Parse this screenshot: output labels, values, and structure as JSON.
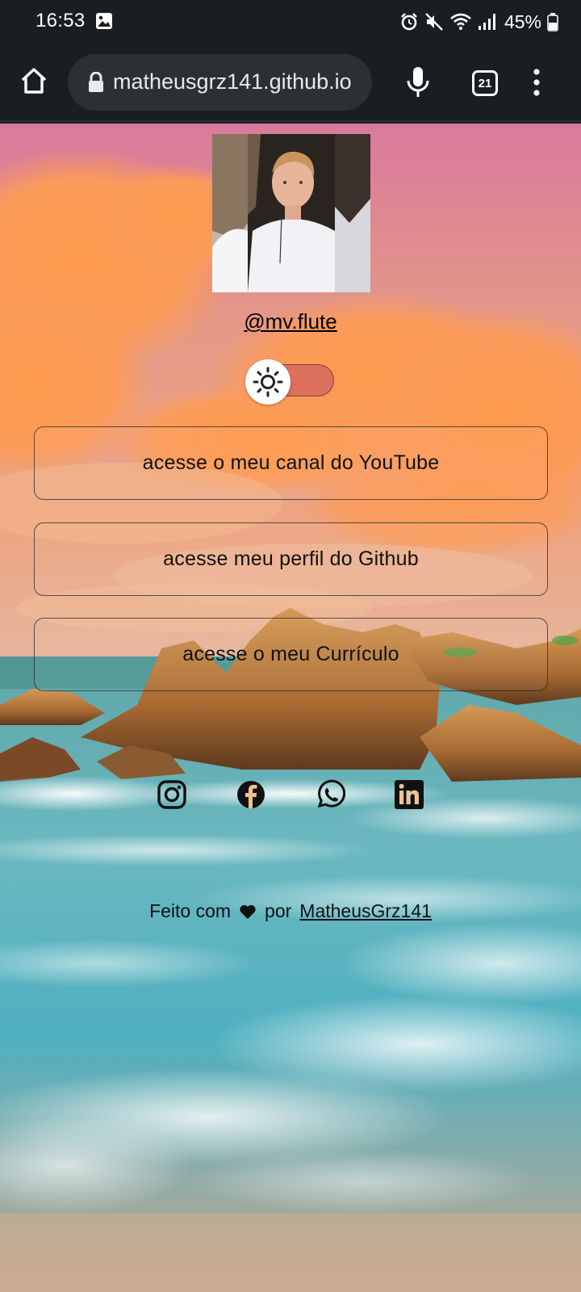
{
  "status_bar": {
    "time": "16:53",
    "battery_percent": "45%",
    "icons": [
      "gallery-icon",
      "alarm-icon",
      "mute-icon",
      "wifi-icon",
      "signal-icon",
      "battery-icon"
    ]
  },
  "browser": {
    "url": "matheusgrz141.github.io",
    "tab_count": "21",
    "icons": [
      "home-icon",
      "lock-icon",
      "mic-icon",
      "tabs-icon",
      "more-menu-icon"
    ]
  },
  "profile": {
    "handle": "@mv.flute",
    "theme_toggle_icon": "sun-icon"
  },
  "links": [
    {
      "label": "acesse o meu canal do YouTube"
    },
    {
      "label": "acesse meu perfil do Github"
    },
    {
      "label": "acesse o meu Currículo"
    }
  ],
  "socials": [
    "instagram-icon",
    "facebook-icon",
    "whatsapp-icon",
    "linkedin-icon"
  ],
  "footer": {
    "prefix": "Feito com",
    "middle": "por",
    "author": "MatheusGrz141"
  },
  "colors": {
    "chrome_bg": "#1b1e21",
    "url_pill_bg": "#2b3034",
    "toggle_track": "#d7695f"
  }
}
